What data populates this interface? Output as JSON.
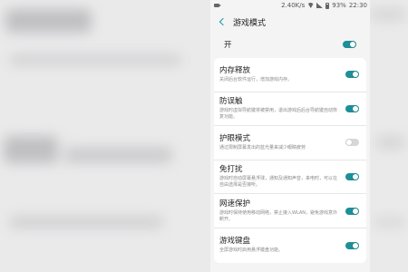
{
  "status_bar": {
    "speed": "2.40K/s",
    "battery": "93%",
    "time": "22:30"
  },
  "header": {
    "title": "游戏模式"
  },
  "master_toggle": {
    "label": "开",
    "on": true
  },
  "settings": [
    {
      "title": "内存释放",
      "desc": "关闭后台软件运行，增加游戏内存。",
      "on": true
    },
    {
      "title": "防误触",
      "desc": "游戏时虚拟导航键将被禁用，退出游戏后后台导航键自动恢复功能。",
      "on": true
    },
    {
      "title": "护眼模式",
      "desc": "通过限制屏幕发出的蓝光量来减少眼睛疲劳",
      "on": false
    },
    {
      "title": "免打扰",
      "desc": "游戏时自动屏幕悬浮球，通知及通知声音，来电时，可以在自由选择是否接听。",
      "on": true
    },
    {
      "title": "网速保护",
      "desc": "游戏时保持使用移动网络，禁止接入WLAN，避免游戏意外断开。",
      "on": true
    },
    {
      "title": "游戏键盘",
      "desc": "全屏游戏时启用悬浮键盘功能。",
      "on": true
    }
  ],
  "colors": {
    "accent": "#1d8f97",
    "toggle_off": "#d7d7d7"
  }
}
